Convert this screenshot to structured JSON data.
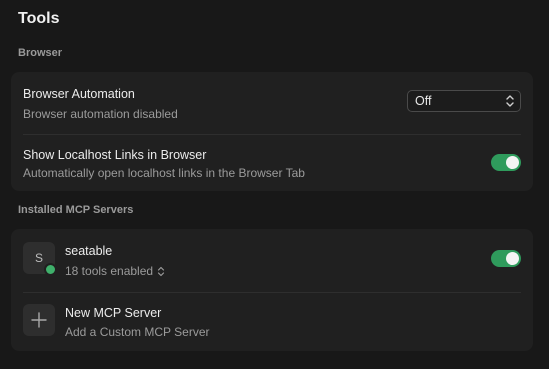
{
  "header": {
    "title": "Tools"
  },
  "browser_section": {
    "label": "Browser",
    "automation": {
      "title": "Browser Automation",
      "subtitle": "Browser automation disabled",
      "selected": "Off"
    },
    "localhost": {
      "title": "Show Localhost Links in Browser",
      "subtitle": "Automatically open localhost links in the Browser Tab",
      "enabled": true
    }
  },
  "mcp_section": {
    "label": "Installed MCP Servers",
    "servers": [
      {
        "avatar_letter": "S",
        "name": "seatable",
        "tools_text": "18 tools enabled",
        "enabled": true,
        "status_color": "#3fb06b"
      }
    ],
    "new_server": {
      "title": "New MCP Server",
      "subtitle": "Add a Custom MCP Server"
    }
  },
  "colors": {
    "background": "#181818",
    "card": "#202020",
    "toggle_on": "#2f9b5c"
  },
  "icons": {
    "select_chevron": "chevron-up-down-icon",
    "tools_chevron": "chevron-up-down-icon",
    "add": "plus-icon"
  }
}
